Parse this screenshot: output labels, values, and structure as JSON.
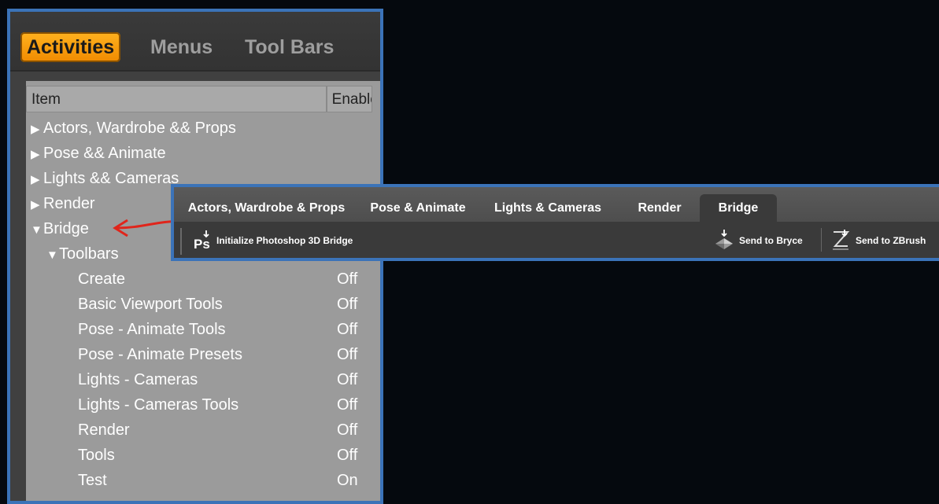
{
  "dialog": {
    "tabs": [
      {
        "label": "Activities",
        "active": true
      },
      {
        "label": "Menus",
        "active": false
      },
      {
        "label": "Tool Bars",
        "active": false
      }
    ],
    "columns": {
      "item": "Item",
      "enabled": "Enabled"
    },
    "rows": [
      {
        "label": "Actors, Wardrobe && Props",
        "state": "",
        "expanded": false
      },
      {
        "label": "Pose && Animate",
        "state": "",
        "expanded": false
      },
      {
        "label": "Lights && Cameras",
        "state": "",
        "expanded": false
      },
      {
        "label": "Render",
        "state": "",
        "expanded": false
      },
      {
        "label": "Bridge",
        "state": "",
        "expanded": true
      },
      {
        "label": "Toolbars",
        "state": "",
        "expanded": true
      },
      {
        "label": "Create",
        "state": "Off"
      },
      {
        "label": "Basic Viewport Tools",
        "state": "Off"
      },
      {
        "label": "Pose - Animate Tools",
        "state": "Off"
      },
      {
        "label": "Pose - Animate Presets",
        "state": "Off"
      },
      {
        "label": "Lights - Cameras",
        "state": "Off"
      },
      {
        "label": "Lights - Cameras Tools",
        "state": "Off"
      },
      {
        "label": "Render",
        "state": "Off"
      },
      {
        "label": "Tools",
        "state": "Off"
      },
      {
        "label": "Test",
        "state": "On"
      }
    ]
  },
  "toolbar": {
    "tabs": [
      {
        "label": "Actors, Wardrobe & Props",
        "active": false
      },
      {
        "label": "Pose & Animate",
        "active": false
      },
      {
        "label": "Lights & Cameras",
        "active": false
      },
      {
        "label": "Render",
        "active": false
      },
      {
        "label": "Bridge",
        "active": true
      }
    ],
    "buttons": {
      "photoshop": {
        "label": "Initialize Photoshop 3D Bridge",
        "icon": "photoshop-icon"
      },
      "bryce": {
        "label": "Send to Bryce",
        "icon": "bryce-icon"
      },
      "zbrush": {
        "label": "Send to ZBrush",
        "icon": "zbrush-icon"
      }
    }
  },
  "colors": {
    "accent_border": "#3b73b8",
    "active_tab": "#f39200",
    "arrow": "#e0251b"
  }
}
